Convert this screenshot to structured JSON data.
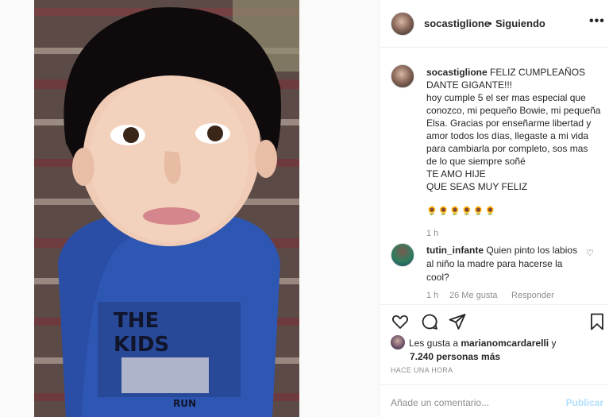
{
  "post": {
    "username": "socastiglione",
    "separator": "•",
    "follow_state": "Siguiendo",
    "more_icon": "more-horizontal-icon"
  },
  "caption": {
    "username": "socastiglione",
    "text": " FELIZ CUMPLEAÑOS DANTE GIGANTE!!!\nhoy cumple 5 el ser mas especial que conozco, mi pequeño Bowie, mi pequeña Elsa. Gracias por enseñarme libertad y amor todos los días, llegaste a mi vida para cambiarla por completo, sos mas de lo que siempre soñé\nTE AMO HIJE\nQUE SEAS MUY FELIZ",
    "emojis": "🌻🌻🌻🌻🌻🌻",
    "time": "1 h"
  },
  "reply": {
    "username": "tutin_infante",
    "text": " Quien pinto los labios al niño la madre para hacerse la cool?",
    "time": "1 h",
    "likes": "26 Me gusta",
    "reply_label": "Responder"
  },
  "likes": {
    "prefix": "Les gusta a ",
    "user": "marianomcardarelli",
    "connector": " y",
    "count": "7.240 personas más"
  },
  "post_time": "HACE UNA HORA",
  "composer": {
    "placeholder": "Añade un comentario...",
    "submit": "Publicar"
  },
  "photo": {
    "shirt_text_line1": "THE",
    "shirt_text_line2": "KIDS",
    "shirt_text_line3": "RUN"
  }
}
